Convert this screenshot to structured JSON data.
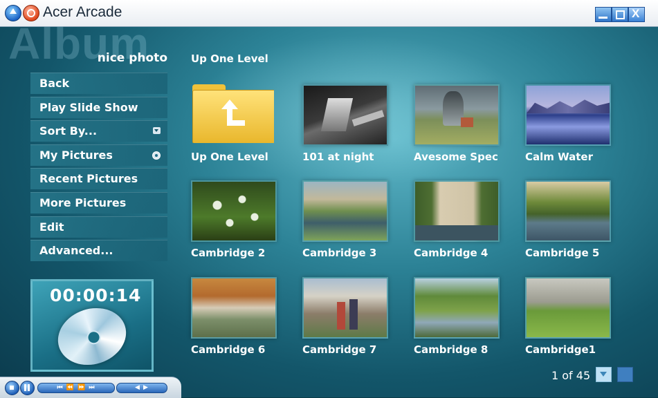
{
  "window": {
    "title": "Acer Arcade"
  },
  "album": {
    "watermark": "Album",
    "name": "nice photo"
  },
  "menu": {
    "items": [
      {
        "label": "Back"
      },
      {
        "label": "Play Slide Show"
      },
      {
        "label": "Sort By..."
      },
      {
        "label": "My Pictures"
      },
      {
        "label": "Recent Pictures"
      },
      {
        "label": "More Pictures"
      },
      {
        "label": "Edit"
      },
      {
        "label": "Advanced..."
      }
    ]
  },
  "now_playing": {
    "time": "00:00:14",
    "icon": "disc-icon"
  },
  "content": {
    "up_level_label": "Up One Level",
    "tiles": [
      {
        "caption": "Up One Level",
        "kind": "folder"
      },
      {
        "caption": "101 at night"
      },
      {
        "caption": "Avesome Spec"
      },
      {
        "caption": "Calm Water"
      },
      {
        "caption": "Cambridge 2"
      },
      {
        "caption": "Cambridge 3"
      },
      {
        "caption": "Cambridge 4"
      },
      {
        "caption": "Cambridge 5"
      },
      {
        "caption": "Cambridge 6"
      },
      {
        "caption": "Cambridge 7"
      },
      {
        "caption": "Cambridge 8"
      },
      {
        "caption": "Cambridge1"
      }
    ]
  },
  "pager": {
    "text": "1 of 45"
  },
  "colors": {
    "accent": "#1d6b86",
    "background": "#13566a",
    "folder": "#f0c23a"
  }
}
